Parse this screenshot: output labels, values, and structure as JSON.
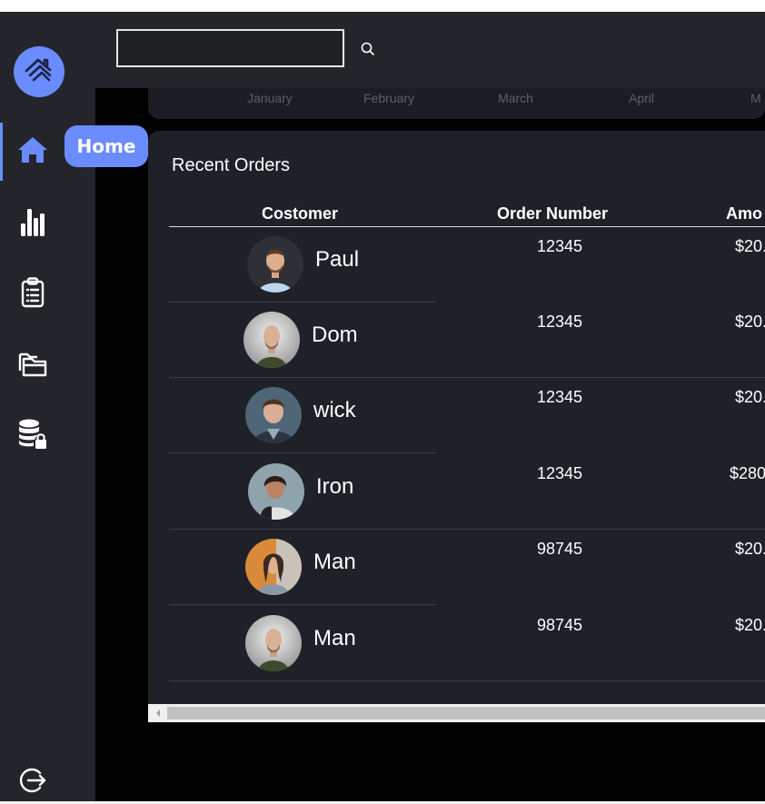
{
  "sidebar": {
    "tooltip": "Home",
    "items": [
      {
        "id": "home",
        "icon": "home-icon"
      },
      {
        "id": "analytics",
        "icon": "bar-chart-icon"
      },
      {
        "id": "tasks",
        "icon": "clipboard-list-icon"
      },
      {
        "id": "files",
        "icon": "folders-icon"
      },
      {
        "id": "database",
        "icon": "database-lock-icon"
      }
    ],
    "logout_icon": "logout-icon",
    "accent": "#6b8cff"
  },
  "search": {
    "value": "",
    "icon": "search-icon"
  },
  "chart": {
    "months": [
      "January",
      "February",
      "March",
      "April",
      "M"
    ]
  },
  "orders": {
    "title": "Recent Orders",
    "columns": [
      "Costomer",
      "Order Number",
      "Amo"
    ],
    "rows": [
      {
        "customer": "Paul",
        "order": "12345",
        "amount": "$20."
      },
      {
        "customer": "Dom",
        "order": "12345",
        "amount": "$20."
      },
      {
        "customer": "wick",
        "order": "12345",
        "amount": "$20."
      },
      {
        "customer": "Iron",
        "order": "12345",
        "amount": "$280"
      },
      {
        "customer": "Man",
        "order": "98745",
        "amount": "$20."
      },
      {
        "customer": "Man",
        "order": "98745",
        "amount": "$20."
      }
    ]
  },
  "colors": {
    "background": "#000000",
    "panel": "#24252a",
    "card": "#1f2128"
  }
}
